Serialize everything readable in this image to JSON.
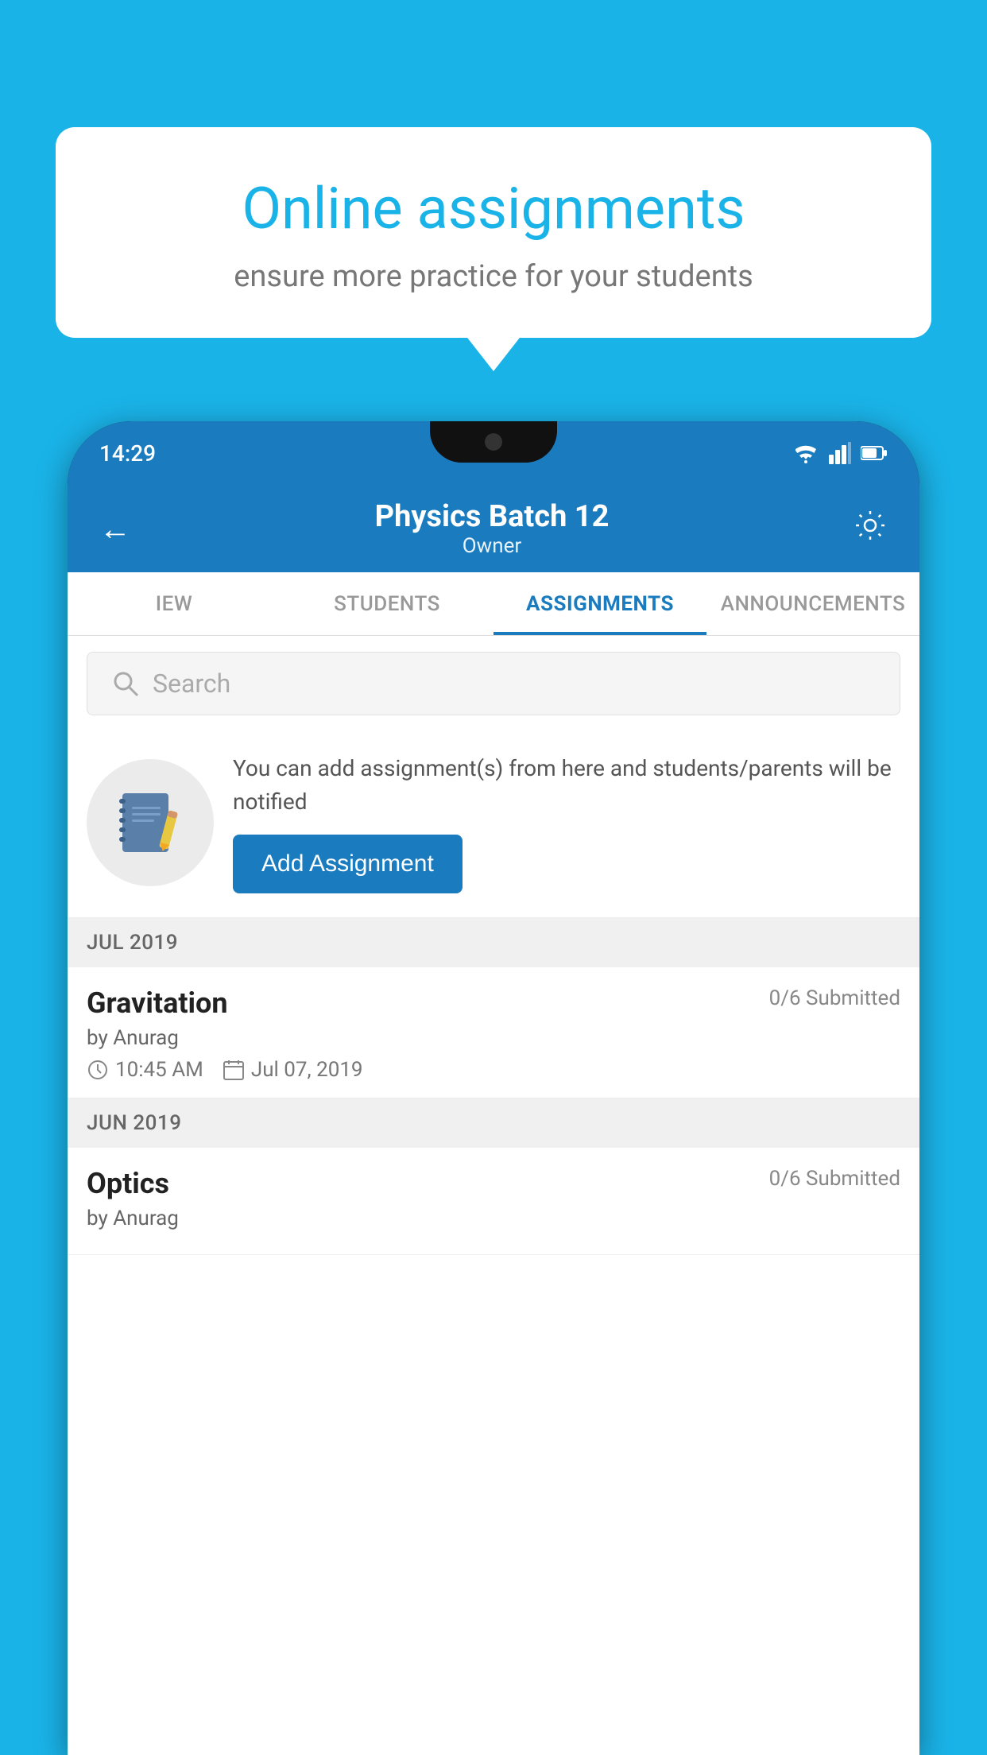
{
  "background": {
    "color": "#1ab3e8"
  },
  "speech_bubble": {
    "title": "Online assignments",
    "subtitle": "ensure more practice for your students"
  },
  "phone": {
    "status_bar": {
      "time": "14:29",
      "icons": [
        "wifi",
        "signal",
        "battery"
      ]
    },
    "app_bar": {
      "title": "Physics Batch 12",
      "subtitle": "Owner",
      "back_label": "←",
      "settings_label": "⚙"
    },
    "tabs": [
      {
        "label": "IEW",
        "active": false
      },
      {
        "label": "STUDENTS",
        "active": false
      },
      {
        "label": "ASSIGNMENTS",
        "active": true
      },
      {
        "label": "ANNOUNCEMENTS",
        "active": false
      }
    ],
    "search": {
      "placeholder": "Search"
    },
    "promo": {
      "text": "You can add assignment(s) from here and students/parents will be notified",
      "button_label": "Add Assignment"
    },
    "months": [
      {
        "label": "JUL 2019",
        "assignments": [
          {
            "name": "Gravitation",
            "submitted": "0/6 Submitted",
            "by": "by Anurag",
            "time": "10:45 AM",
            "date": "Jul 07, 2019"
          }
        ]
      },
      {
        "label": "JUN 2019",
        "assignments": [
          {
            "name": "Optics",
            "submitted": "0/6 Submitted",
            "by": "by Anurag",
            "time": "",
            "date": ""
          }
        ]
      }
    ]
  }
}
